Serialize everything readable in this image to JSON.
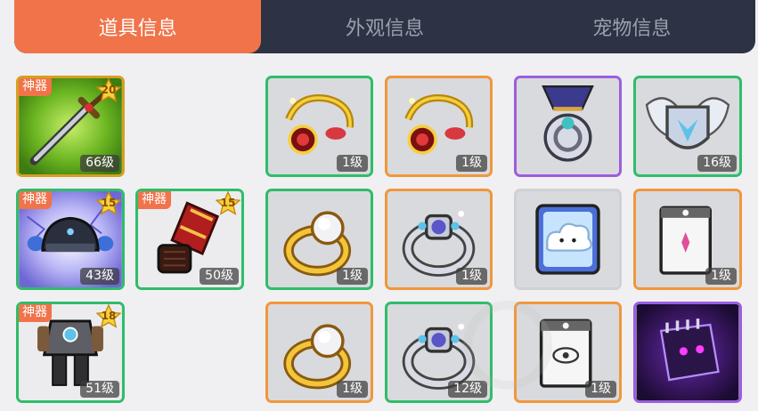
{
  "tabs": [
    {
      "label": "道具信息",
      "active": true
    },
    {
      "label": "外观信息",
      "active": false
    },
    {
      "label": "宠物信息",
      "active": false
    }
  ],
  "colors": {
    "active_tab": "#f0734a",
    "tab_bar": "#2d3344",
    "rarity_gold": "#d6a020",
    "rarity_green": "#2fbd6a",
    "rarity_orange": "#f0973c",
    "rarity_purple": "#9b5ee0"
  },
  "items": [
    {
      "name": "sword",
      "icon": "sword-icon",
      "tag": "神器",
      "star": "20",
      "level": "66级",
      "rarity": "gold"
    },
    {
      "name": "helmet",
      "icon": "helmet-icon",
      "tag": "神器",
      "star": "15",
      "level": "43级",
      "rarity": "green"
    },
    {
      "name": "gauntlet",
      "icon": "gauntlet-icon",
      "tag": "神器",
      "star": "15",
      "level": "50级",
      "rarity": "green"
    },
    {
      "name": "armor",
      "icon": "armor-icon",
      "tag": "神器",
      "star": "18",
      "level": "51级",
      "rarity": "green"
    },
    {
      "name": "pendant-1",
      "icon": "pendant-icon",
      "level": "1级",
      "rarity": "green"
    },
    {
      "name": "pendant-2",
      "icon": "pendant-icon",
      "level": "1级",
      "rarity": "orange"
    },
    {
      "name": "ring-1",
      "icon": "ring-icon",
      "level": "1级",
      "rarity": "green"
    },
    {
      "name": "gem-ring-1",
      "icon": "gem-ring-icon",
      "level": "1级",
      "rarity": "orange"
    },
    {
      "name": "ring-2",
      "icon": "ring-icon",
      "level": "1级",
      "rarity": "orange"
    },
    {
      "name": "gem-ring-2",
      "icon": "gem-ring-icon",
      "level": "12级",
      "rarity": "green"
    },
    {
      "name": "medal",
      "icon": "medal-icon",
      "rarity": "purple"
    },
    {
      "name": "wing-emblem",
      "icon": "wing-emblem-icon",
      "level": "16级",
      "rarity": "green"
    },
    {
      "name": "cloud-card",
      "icon": "cloud-card-icon",
      "rarity": "gray"
    },
    {
      "name": "star-card",
      "icon": "card-icon",
      "level": "1级",
      "rarity": "orange"
    },
    {
      "name": "eye-card",
      "icon": "card-icon",
      "level": "1级",
      "rarity": "orange"
    },
    {
      "name": "dark-book",
      "icon": "dark-book-icon",
      "rarity": "purple"
    }
  ]
}
